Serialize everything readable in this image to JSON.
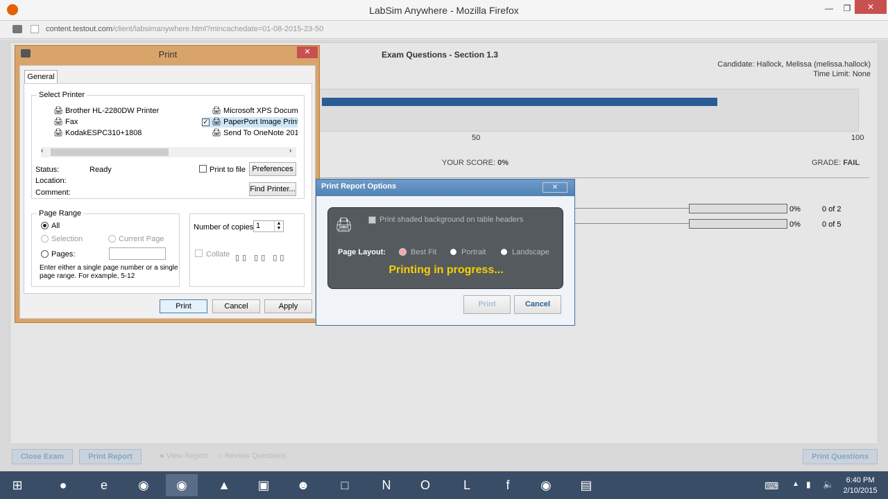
{
  "browser": {
    "title": "LabSim Anywhere - Mozilla Firefox",
    "url_domain": "content.testout.com",
    "url_path": "/client/labsimanywhere.html?mincachedate=01-08-2015-23-50"
  },
  "exam": {
    "heading": "Exam Questions - Section 1.3",
    "candidate": "Candidate: Hallock, Melissa (melissa.hallock)",
    "time_limit": "Time Limit: None",
    "scale_50": "50",
    "scale_100": "100",
    "your_score_label": "YOUR SCORE:",
    "your_score_value": "0%",
    "grade_label": "GRADE:",
    "grade_value": "FAIL",
    "rows": [
      {
        "pct": "0%",
        "count": "0 of 2"
      },
      {
        "pct": "0%",
        "count": "0 of 5"
      }
    ],
    "footer_buttons": {
      "close_exam": "Close Exam",
      "print_report": "Print Report",
      "view_report": "View Report",
      "review_questions": "Review Questions",
      "print_questions": "Print Questions"
    }
  },
  "print_dialog": {
    "title": "Print",
    "tab_general": "General",
    "select_printer": "Select Printer",
    "printers": [
      "Brother HL-2280DW Printer",
      "Fax",
      "KodakESPC310+1808",
      "Microsoft XPS Docum",
      "PaperPort Image Print",
      "Send To OneNote 201"
    ],
    "status_label": "Status:",
    "status_value": "Ready",
    "location_label": "Location:",
    "comment_label": "Comment:",
    "print_to_file": "Print to file",
    "preferences": "Preferences",
    "find_printer": "Find Printer...",
    "page_range": "Page Range",
    "all": "All",
    "selection": "Selection",
    "current_page": "Current Page",
    "pages": "Pages:",
    "hint": "Enter either a single page number or a single page range.  For example, 5-12",
    "copies_label": "Number of copies:",
    "copies_value": "1",
    "collate": "Collate",
    "btn_print": "Print",
    "btn_cancel": "Cancel",
    "btn_apply": "Apply"
  },
  "report_dialog": {
    "title": "Print Report Options",
    "shaded": "Print shaded background on table headers",
    "page_layout": "Page Layout:",
    "best_fit": "Best Fit",
    "portrait": "Portrait",
    "landscape": "Landscape",
    "progress": "Printing in progress...",
    "btn_print": "Print",
    "btn_cancel": "Cancel"
  },
  "taskbar": {
    "time": "6:40 PM",
    "date": "2/10/2015"
  },
  "colors": {
    "accent": "#2a5d96",
    "progress_text": "#f5d000"
  }
}
